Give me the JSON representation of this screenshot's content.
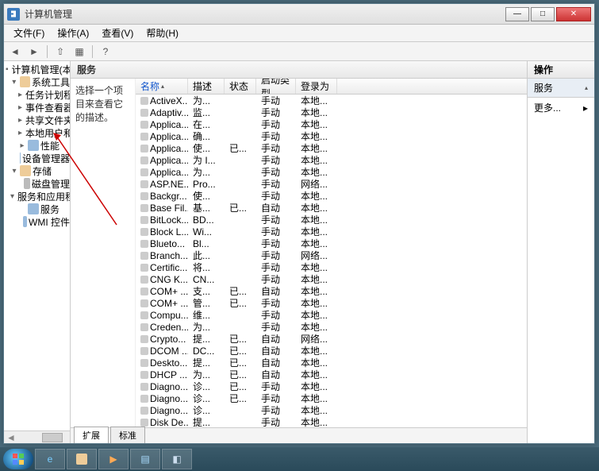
{
  "window": {
    "title": "计算机管理"
  },
  "menu": {
    "file": "文件(F)",
    "action": "操作(A)",
    "view": "查看(V)",
    "help": "帮助(H)"
  },
  "tree": {
    "root": "计算机管理(本地)",
    "systools": "系统工具",
    "tasksched": "任务计划程序",
    "eventvwr": "事件查看器",
    "shared": "共享文件夹",
    "localusr": "本地用户和组",
    "perf": "性能",
    "devmgr": "设备管理器",
    "storage": "存储",
    "diskmgr": "磁盘管理",
    "svcapp": "服务和应用程序",
    "services": "服务",
    "wmi": "WMI 控件"
  },
  "mid": {
    "header": "服务",
    "desc": "选择一个项目来查看它的描述。",
    "tabs": {
      "ext": "扩展",
      "std": "标准"
    },
    "cols": {
      "name": "名称",
      "desc": "描述",
      "stat": "状态",
      "start": "启动类型",
      "logon": "登录为"
    }
  },
  "actions": {
    "header": "操作",
    "group": "服务",
    "more": "更多..."
  },
  "rows": [
    {
      "n": "ActiveX...",
      "d": "为...",
      "s": "",
      "t": "手动",
      "l": "本地..."
    },
    {
      "n": "Adaptiv...",
      "d": "监...",
      "s": "",
      "t": "手动",
      "l": "本地..."
    },
    {
      "n": "Applica...",
      "d": "在...",
      "s": "",
      "t": "手动",
      "l": "本地..."
    },
    {
      "n": "Applica...",
      "d": "确...",
      "s": "",
      "t": "手动",
      "l": "本地..."
    },
    {
      "n": "Applica...",
      "d": "使...",
      "s": "已...",
      "t": "手动",
      "l": "本地..."
    },
    {
      "n": "Applica...",
      "d": "为 I...",
      "s": "",
      "t": "手动",
      "l": "本地..."
    },
    {
      "n": "Applica...",
      "d": "为...",
      "s": "",
      "t": "手动",
      "l": "本地..."
    },
    {
      "n": "ASP.NE...",
      "d": "Pro...",
      "s": "",
      "t": "手动",
      "l": "网络..."
    },
    {
      "n": "Backgr...",
      "d": "使...",
      "s": "",
      "t": "手动",
      "l": "本地..."
    },
    {
      "n": "Base Fil...",
      "d": "基...",
      "s": "已...",
      "t": "自动",
      "l": "本地..."
    },
    {
      "n": "BitLock...",
      "d": "BD...",
      "s": "",
      "t": "手动",
      "l": "本地..."
    },
    {
      "n": "Block L...",
      "d": "Wi...",
      "s": "",
      "t": "手动",
      "l": "本地..."
    },
    {
      "n": "Blueto...",
      "d": "Bl...",
      "s": "",
      "t": "手动",
      "l": "本地..."
    },
    {
      "n": "Branch...",
      "d": "此...",
      "s": "",
      "t": "手动",
      "l": "网络..."
    },
    {
      "n": "Certific...",
      "d": "将...",
      "s": "",
      "t": "手动",
      "l": "本地..."
    },
    {
      "n": "CNG K...",
      "d": "CN...",
      "s": "",
      "t": "手动",
      "l": "本地..."
    },
    {
      "n": "COM+ ...",
      "d": "支...",
      "s": "已...",
      "t": "自动",
      "l": "本地..."
    },
    {
      "n": "COM+ ...",
      "d": "管...",
      "s": "已...",
      "t": "手动",
      "l": "本地..."
    },
    {
      "n": "Compu...",
      "d": "维...",
      "s": "",
      "t": "手动",
      "l": "本地..."
    },
    {
      "n": "Creden...",
      "d": "为...",
      "s": "",
      "t": "手动",
      "l": "本地..."
    },
    {
      "n": "Crypto...",
      "d": "提...",
      "s": "已...",
      "t": "自动",
      "l": "网络..."
    },
    {
      "n": "DCOM ...",
      "d": "DC...",
      "s": "已...",
      "t": "自动",
      "l": "本地..."
    },
    {
      "n": "Deskto...",
      "d": "提...",
      "s": "已...",
      "t": "自动",
      "l": "本地..."
    },
    {
      "n": "DHCP ...",
      "d": "为...",
      "s": "已...",
      "t": "自动",
      "l": "本地..."
    },
    {
      "n": "Diagno...",
      "d": "诊...",
      "s": "已...",
      "t": "手动",
      "l": "本地..."
    },
    {
      "n": "Diagno...",
      "d": "诊...",
      "s": "已...",
      "t": "手动",
      "l": "本地..."
    },
    {
      "n": "Diagno...",
      "d": "诊...",
      "s": "",
      "t": "手动",
      "l": "本地..."
    },
    {
      "n": "Disk De...",
      "d": "提...",
      "s": "",
      "t": "手动",
      "l": "本地..."
    }
  ]
}
